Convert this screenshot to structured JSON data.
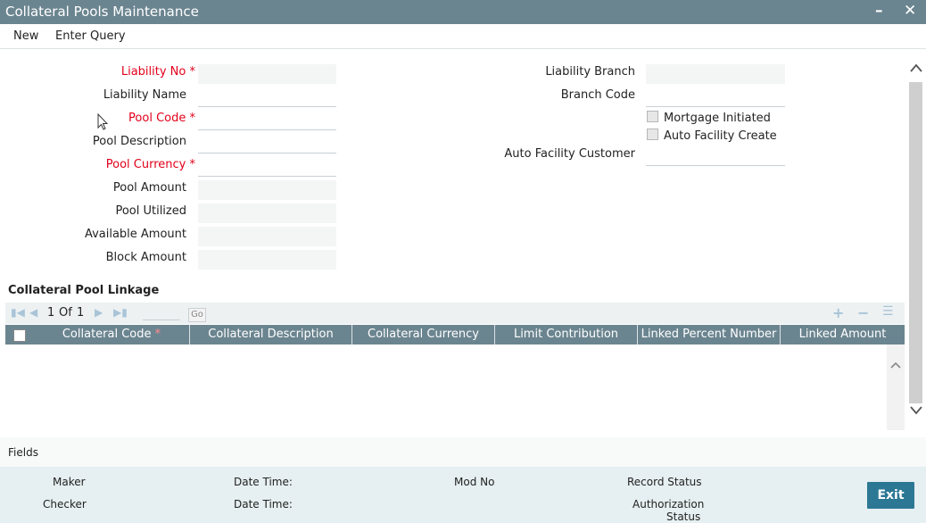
{
  "window": {
    "title": "Collateral Pools Maintenance",
    "minimize": "–",
    "close": "✕"
  },
  "menu": {
    "new": "New",
    "enter_query": "Enter Query"
  },
  "form": {
    "liability_no": {
      "label": "Liability No",
      "required": "*",
      "value": ""
    },
    "liability_name": {
      "label": "Liability Name",
      "value": ""
    },
    "pool_code": {
      "label": "Pool Code",
      "required": "*",
      "value": ""
    },
    "pool_description": {
      "label": "Pool Description",
      "value": ""
    },
    "pool_currency": {
      "label": "Pool Currency",
      "required": "*",
      "value": ""
    },
    "pool_amount": {
      "label": "Pool Amount",
      "value": ""
    },
    "pool_utilized": {
      "label": "Pool Utilized",
      "value": ""
    },
    "available_amount": {
      "label": "Available Amount",
      "value": ""
    },
    "block_amount": {
      "label": "Block Amount",
      "value": ""
    },
    "liability_branch": {
      "label": "Liability Branch",
      "value": ""
    },
    "branch_code": {
      "label": "Branch Code",
      "value": ""
    },
    "mortgage_initiated": {
      "label": "Mortgage Initiated",
      "checked": false
    },
    "auto_facility_create": {
      "label": "Auto Facility Create",
      "checked": false
    },
    "auto_facility_customer": {
      "label": "Auto Facility Customer",
      "value": ""
    }
  },
  "linkage": {
    "title": "Collateral Pool Linkage",
    "pager": {
      "current": "1",
      "of": "Of",
      "total": "1",
      "go": "Go"
    },
    "columns": [
      {
        "label": "Collateral Code",
        "required": "*"
      },
      {
        "label": "Collateral Description"
      },
      {
        "label": "Collateral Currency"
      },
      {
        "label": "Limit Contribution"
      },
      {
        "label": "Linked Percent Number"
      },
      {
        "label": "Linked Amount"
      }
    ],
    "rows": []
  },
  "fields_bar": {
    "label": "Fields"
  },
  "footer": {
    "maker": "Maker",
    "checker": "Checker",
    "date_time_1": "Date Time:",
    "date_time_2": "Date Time:",
    "mod_no": "Mod No",
    "record_status": "Record Status",
    "authorization_status_1": "Authorization",
    "authorization_status_2": "Status",
    "exit": "Exit"
  }
}
